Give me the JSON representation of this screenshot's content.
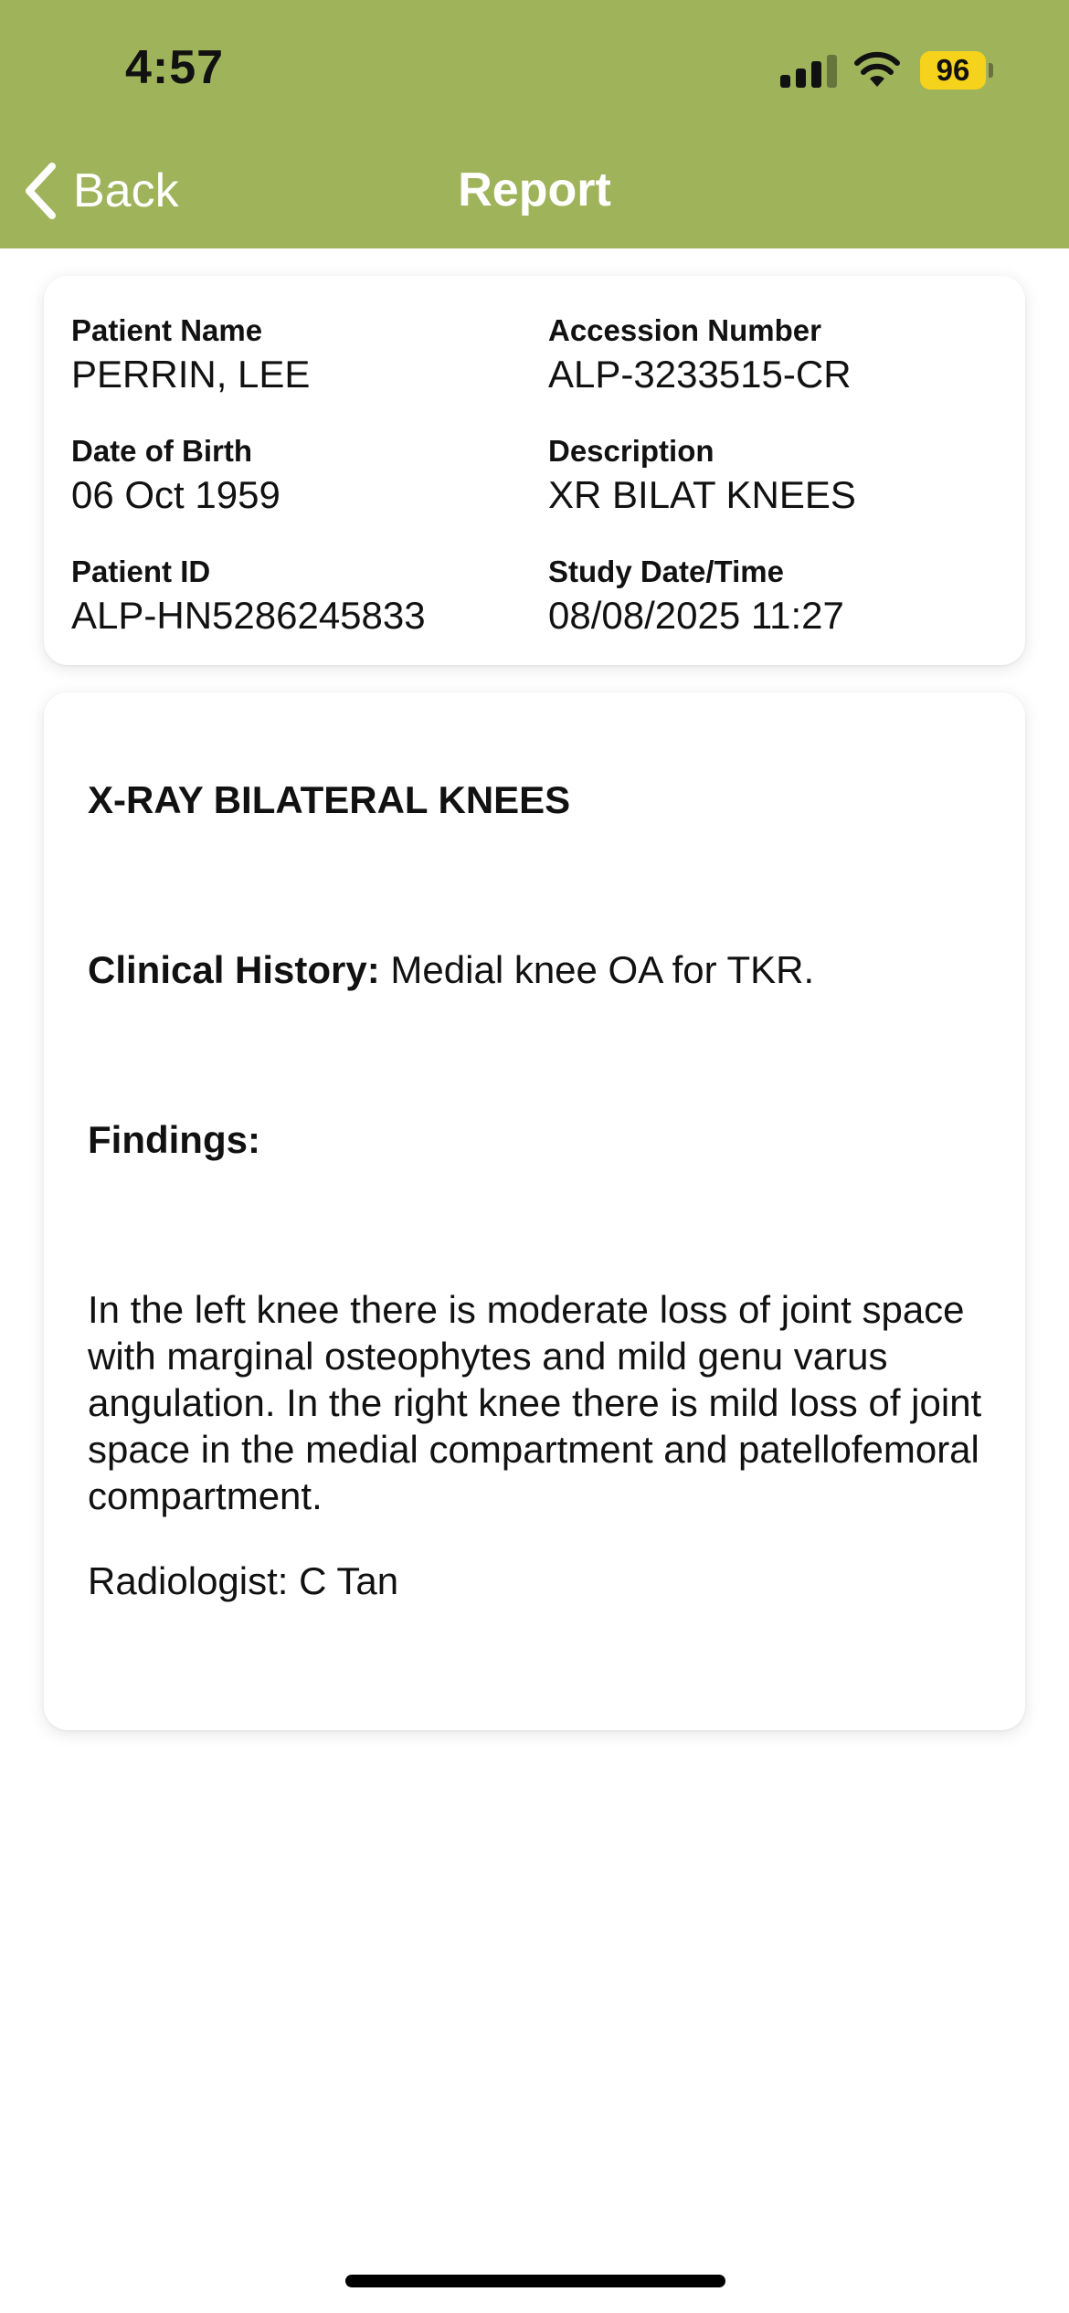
{
  "status_bar": {
    "time": "4:57",
    "battery_level": "96",
    "signal_icon": "cellular-signal-icon",
    "wifi_icon": "wifi-icon",
    "battery_icon": "battery-icon"
  },
  "nav": {
    "back_label": "Back",
    "back_icon": "chevron-left-icon",
    "title": "Report"
  },
  "patient": {
    "name_label": "Patient Name",
    "name": "PERRIN, LEE",
    "dob_label": "Date of Birth",
    "dob": "06 Oct 1959",
    "id_label": "Patient ID",
    "id": "ALP-HN5286245833",
    "accession_label": "Accession Number",
    "accession": "ALP-3233515-CR",
    "description_label": "Description",
    "description": "XR BILAT KNEES",
    "study_label": "Study Date/Time",
    "study_datetime": "08/08/2025 11:27"
  },
  "report": {
    "title": "X-RAY BILATERAL KNEES",
    "clinical_history_label": "Clinical History:",
    "clinical_history": "Medial knee OA for TKR.",
    "findings_label": "Findings:",
    "findings_text": "In the left knee there is moderate loss of joint space with marginal osteophytes and mild genu varus angulation. In the right knee there is mild loss of joint space in the medial compartment and patellofemoral compartment.",
    "radiologist": "Radiologist: C Tan"
  },
  "colors": {
    "header_bg": "#9fb35b",
    "battery_fill": "#f5d21b",
    "card_bg": "#ffffff"
  }
}
